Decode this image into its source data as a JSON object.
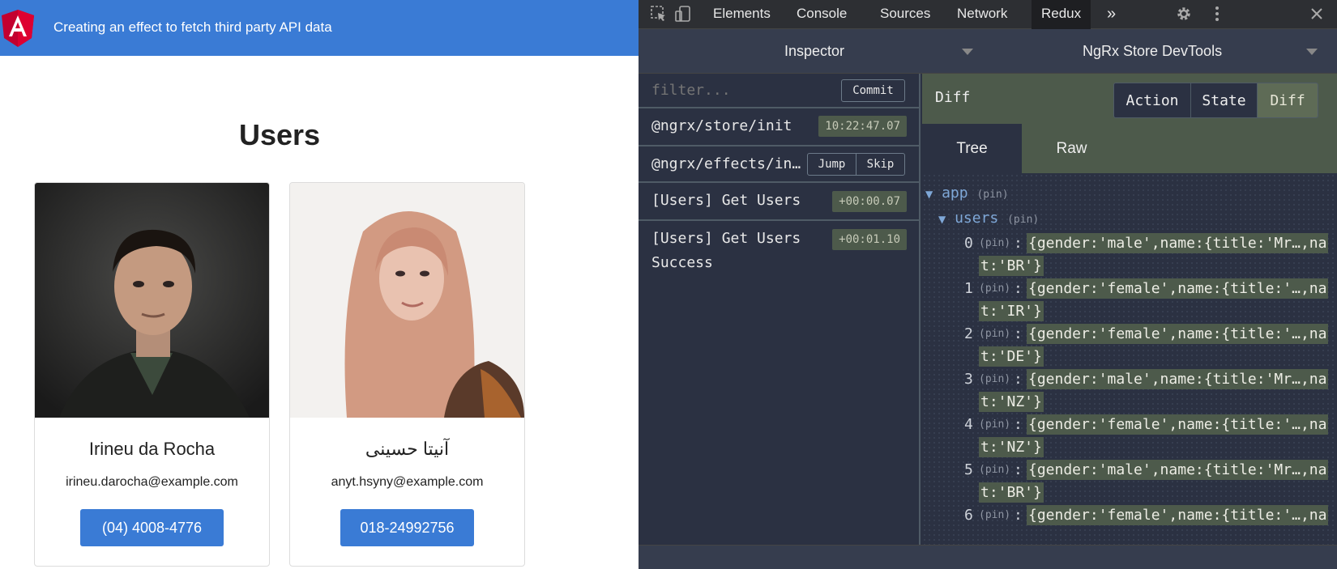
{
  "app": {
    "title": "Creating an effect to fetch third party API data",
    "heading": "Users",
    "users": [
      {
        "name": "Irineu da Rocha",
        "email": "irineu.darocha@example.com",
        "phone": "(04) 4008-4776"
      },
      {
        "name": "آنیتا حسینی",
        "email": "anyt.hsyny@example.com",
        "phone": "018-24992756"
      }
    ],
    "colors": {
      "header": "#3a7bd5",
      "button": "#3a7bd5"
    }
  },
  "devtools": {
    "tabs": [
      "Elements",
      "Console",
      "Sources",
      "Network",
      "Redux"
    ],
    "active_tab": "Redux",
    "more_tabs": "»",
    "inspector_label": "Inspector",
    "monitor_label": "NgRx Store DevTools",
    "filter_placeholder": "filter...",
    "commit_label": "Commit",
    "jump_label": "Jump",
    "skip_label": "Skip",
    "actions": [
      {
        "label": "@ngrx/store/init",
        "time": "10:22:47.07"
      },
      {
        "label": "@ngrx/effects/in…",
        "time": ""
      },
      {
        "label": "[Users] Get Users",
        "time": "+00:00.07"
      },
      {
        "label": "[Users] Get Users Success",
        "label_line1": "[Users] Get Users",
        "label_line2": "Success",
        "time": "+00:01.10"
      }
    ],
    "diff_title": "Diff",
    "modes": [
      "Action",
      "State",
      "Diff"
    ],
    "active_mode": "Diff",
    "view_tabs": [
      "Tree",
      "Raw"
    ],
    "active_view": "Tree",
    "tree": {
      "root_key": "app",
      "child_key": "users",
      "pin_label": "(pin)",
      "items": [
        {
          "index": "0",
          "line1": "{gender:'male',name:{title:'Mr…,na",
          "line2": "t:'BR'}"
        },
        {
          "index": "1",
          "line1": "{gender:'female',name:{title:'…,na",
          "line2": "t:'IR'}"
        },
        {
          "index": "2",
          "line1": "{gender:'female',name:{title:'…,na",
          "line2": "t:'DE'}"
        },
        {
          "index": "3",
          "line1": "{gender:'male',name:{title:'Mr…,na",
          "line2": "t:'NZ'}"
        },
        {
          "index": "4",
          "line1": "{gender:'female',name:{title:'…,na",
          "line2": "t:'NZ'}"
        },
        {
          "index": "5",
          "line1": "{gender:'male',name:{title:'Mr…,na",
          "line2": "t:'BR'}"
        },
        {
          "index": "6",
          "line1": "{gender:'female',name:{title:'…,na",
          "line2": ""
        }
      ]
    }
  }
}
